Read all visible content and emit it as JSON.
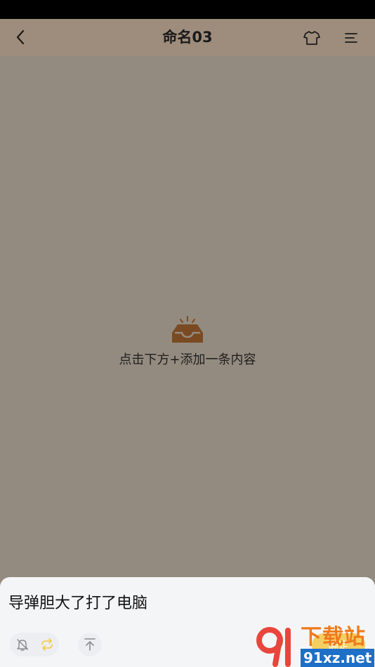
{
  "header": {
    "title": "命名03"
  },
  "empty_state": {
    "message": "点击下方+添加一条内容"
  },
  "composer": {
    "text": "导弹胆大了打了电脑",
    "send_label": "确定"
  },
  "icons": {
    "back": "chevron-left-icon",
    "theme": "shirt-icon",
    "menu": "menu-icon",
    "empty": "inbox-icon",
    "reminder": "bell-off-icon",
    "repeat": "repeat-icon",
    "pin_top": "arrow-to-top-icon"
  },
  "colors": {
    "header_bg": "#9e8d7c",
    "background": "#948b80",
    "accent": "#f3c949",
    "empty_icon": "#7a4a22"
  },
  "watermark": {
    "brand": "下载站",
    "url": "91xz.net"
  }
}
